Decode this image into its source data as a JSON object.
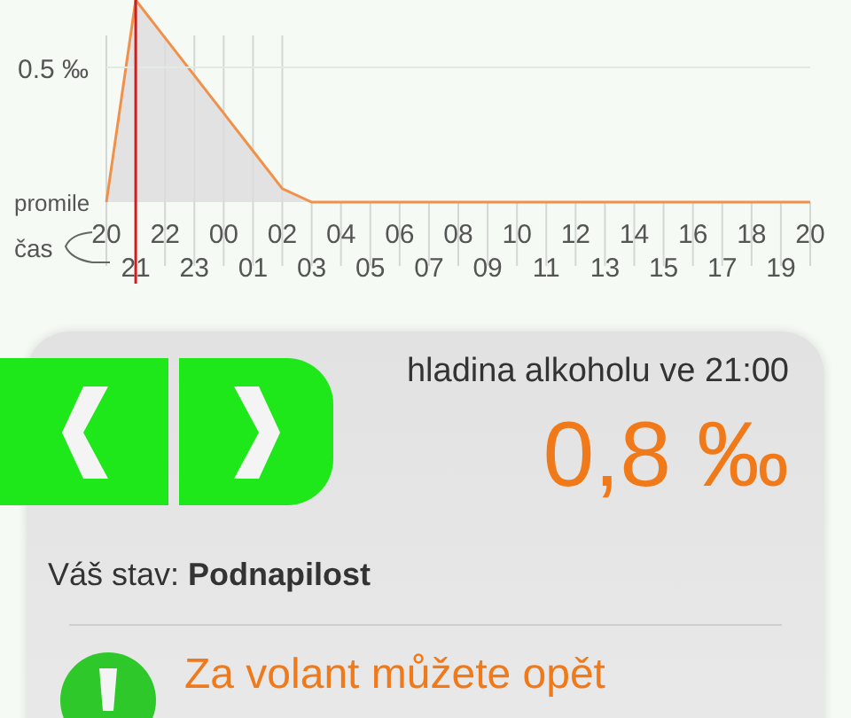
{
  "chart": {
    "chart_data": {
      "type": "area",
      "xlabel": "čas",
      "ylabel": "promile",
      "categories": [
        "20",
        "21",
        "22",
        "23",
        "00",
        "01",
        "02",
        "03",
        "04",
        "05",
        "06",
        "07",
        "08",
        "09",
        "10",
        "11",
        "12",
        "13",
        "14",
        "15",
        "16",
        "17",
        "18",
        "19",
        "20"
      ],
      "series": [
        {
          "color": "#f0904a",
          "values": [
            0,
            0.75,
            0.61,
            0.47,
            0.33,
            0.19,
            0.05,
            0,
            0,
            0,
            0,
            0,
            0,
            0,
            0,
            0,
            0,
            0,
            0,
            0,
            0,
            0,
            0,
            0,
            0
          ]
        }
      ],
      "ylim": [
        0,
        0.75
      ],
      "yticks": [
        {
          "value": 0.5,
          "label": "0.5 ‰"
        }
      ],
      "grid": true,
      "ref_lines": [
        {
          "axis": "y",
          "value": 0.5,
          "color": "#e3e9e3"
        },
        {
          "axis": "x",
          "value": "21",
          "color": "#cc2020"
        }
      ]
    }
  },
  "navigation": [
    {
      "kind": "previous"
    },
    {
      "kind": "next"
    }
  ],
  "level": {
    "label": "hladina alkoholu ve",
    "time": "21:00",
    "value": "0,8 ‰"
  },
  "status": {
    "label": "Váš stav:",
    "value": "Podnapilost"
  },
  "notice": {
    "text": "Za volant můžete opět"
  }
}
